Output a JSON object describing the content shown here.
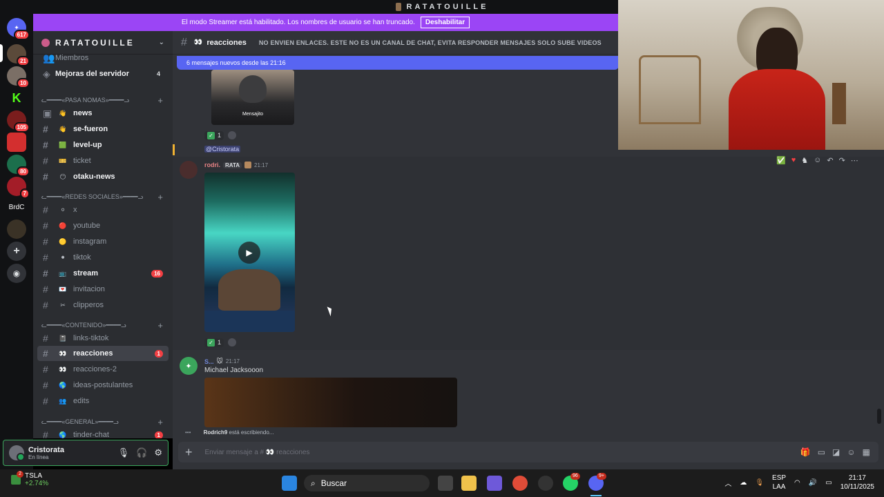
{
  "window_title": "RATATOUILLE",
  "streamer_banner": {
    "text": "El modo Streamer está habilitado. Los nombres de usuario se han truncado.",
    "button": "Deshabilitar"
  },
  "servers": [
    {
      "icon": "discord-home-icon",
      "badge": "617"
    },
    {
      "icon": "ratatouille-server-icon",
      "badge": "21"
    },
    {
      "icon": "user-server-icon",
      "badge": "10"
    },
    {
      "icon": "kick-server-icon",
      "badge": ""
    },
    {
      "icon": "red-server-icon",
      "badge": "105"
    },
    {
      "icon": "pasa-server-icon",
      "badge": ""
    },
    {
      "icon": "link-server-icon",
      "badge": "80"
    },
    {
      "icon": "red-face-server-icon",
      "badge": "7"
    },
    {
      "label": "BrdC"
    },
    {
      "icon": "rat-server-icon",
      "badge": ""
    }
  ],
  "guild": {
    "name": "RATATOUILLE"
  },
  "sidebar": {
    "top_items": [
      {
        "label": "Miembros"
      },
      {
        "label": "Mejoras del servidor",
        "count": "4"
      }
    ],
    "categories": [
      {
        "name": "ᓚ━━━━«PASA NOMAS»━━━━ᓗ",
        "channels": [
          {
            "emoji": "👋",
            "label": "news",
            "bright": true
          },
          {
            "emoji": "👋",
            "label": "se-fueron",
            "bright": true
          },
          {
            "emoji": "🟩",
            "label": "level-up",
            "bright": true
          },
          {
            "emoji": "🎫",
            "label": "ticket",
            "bright": false
          },
          {
            "emoji": "😶",
            "label": "otaku-news",
            "bright": true
          }
        ]
      },
      {
        "name": "ᓚ━━━━«REDES SOCIALES»━━━━ᓗ",
        "channels": [
          {
            "emoji": "⚪",
            "label": "x",
            "bright": false
          },
          {
            "emoji": "🔴",
            "label": "youtube",
            "bright": false
          },
          {
            "emoji": "🟡",
            "label": "instagram",
            "bright": false
          },
          {
            "emoji": "⚫",
            "label": "tiktok",
            "bright": false
          },
          {
            "emoji": "📺",
            "label": "stream",
            "bright": true,
            "badge": "16"
          },
          {
            "emoji": "💌",
            "label": "invitacion",
            "bright": false
          },
          {
            "emoji": "✂",
            "label": "clipperos",
            "bright": false
          }
        ]
      },
      {
        "name": "ᓚ━━━━«CONTENIDO»━━━━ᓗ",
        "channels": [
          {
            "emoji": "📓",
            "label": "links-tiktok",
            "bright": false
          },
          {
            "emoji": "👀",
            "label": "reacciones",
            "bright": true,
            "active": true,
            "badge": "1"
          },
          {
            "emoji": "👀",
            "label": "reacciones-2",
            "bright": false
          },
          {
            "emoji": "🌎",
            "label": "ideas-postulantes",
            "bright": false
          },
          {
            "emoji": "👥",
            "label": "edits",
            "bright": false
          }
        ]
      },
      {
        "name": "ᓚ━━━━«GENERAL»━━━━ᓗ",
        "channels": [
          {
            "emoji": "🌎",
            "label": "tinder-chat",
            "bright": false,
            "badge": "1"
          }
        ]
      }
    ]
  },
  "user_panel": {
    "name": "Cristorata",
    "status": "En línea"
  },
  "channel_header": {
    "emoji": "👀",
    "name": "reacciones",
    "topic": "NO ENVIEN ENLACES. ESTE NO ES UN CANAL DE CHAT, EVITA RESPONDER MENSAJES SOLO SUBE VIDEOS"
  },
  "new_messages_bar": "6 mensajes nuevos desde las 21:16",
  "messages": [
    {
      "thumb_caption": "Mensajito",
      "reaction_count": "1",
      "mention": "@Cristorata"
    },
    {
      "author": "rodri.",
      "role_tag": "RATA",
      "time": "21:17",
      "reaction_count": "1"
    },
    {
      "author": "S...",
      "time": "21:17",
      "text": "Michael Jacksooon"
    }
  ],
  "hover_actions": [
    "check-reaction-icon",
    "heart-reaction-icon",
    "goat-reaction-icon",
    "add-reaction-icon",
    "reply-icon",
    "forward-icon",
    "more-icon"
  ],
  "typing_indicator": {
    "user": "Rodrich9",
    "suffix": "está escribiendo..."
  },
  "composer": {
    "placeholder": "Enviar mensaje a # 👀 reacciones"
  },
  "taskbar": {
    "stock_symbol": "TSLA",
    "stock_change": "+2.74%",
    "stock_badge": "2",
    "search_placeholder": "Buscar",
    "whatsapp_badge": "96",
    "discord_badge": "9+",
    "language": "ESP",
    "layout": "LAA",
    "time": "21:17",
    "date": "10/11/2025"
  },
  "colors": {
    "banner": "#9b45f5",
    "blurple": "#5865f2",
    "online": "#23a55a",
    "mention_badge": "#f23f43"
  }
}
